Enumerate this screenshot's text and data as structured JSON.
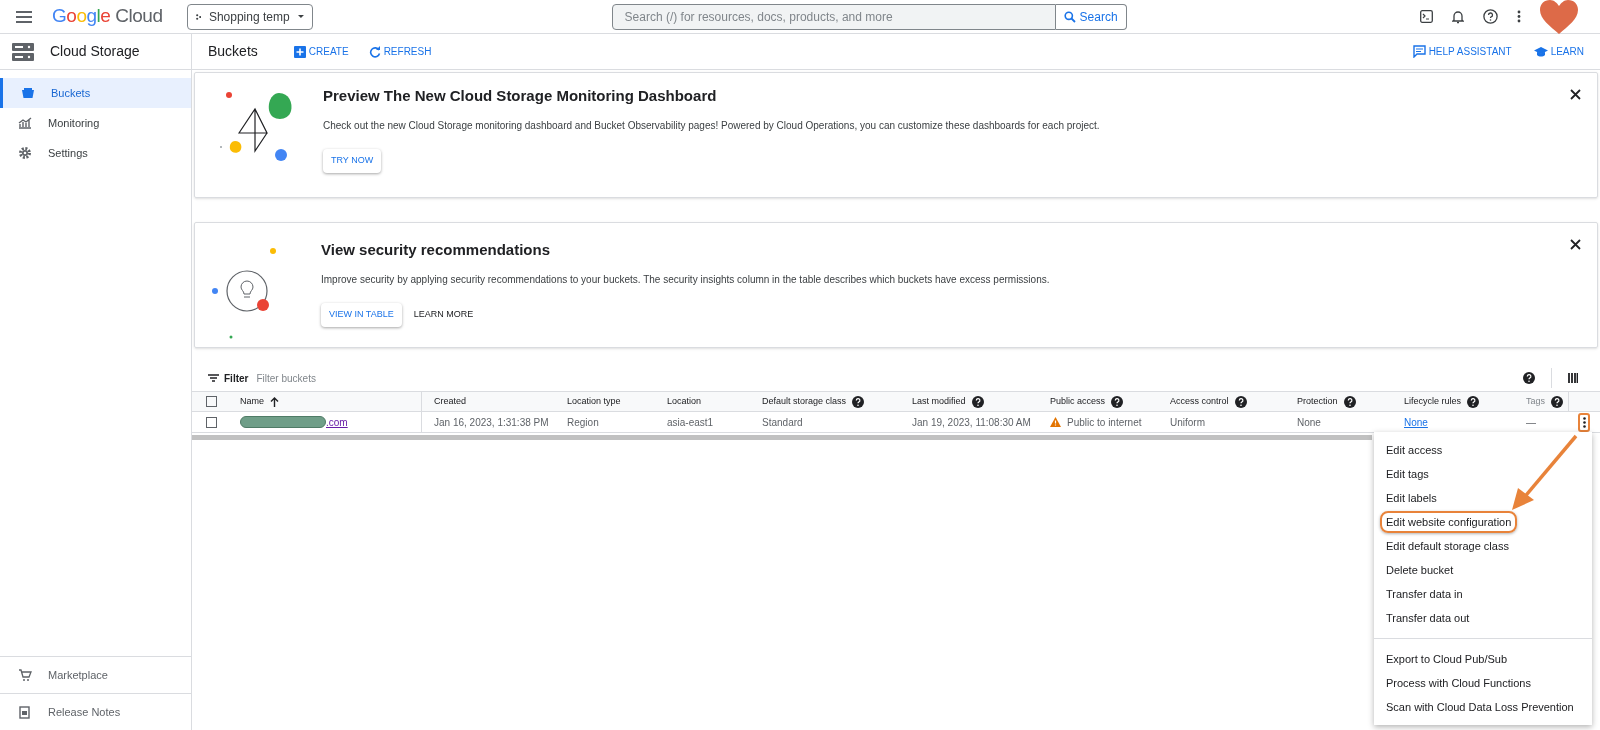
{
  "topbar": {
    "logo_parts": [
      "Google",
      "Cloud"
    ],
    "project": "Shopping temp",
    "search_placeholder": "Search (/) for resources, docs, products, and more",
    "search_button": "Search"
  },
  "sidebar": {
    "title": "Cloud Storage",
    "items": [
      {
        "label": "Buckets",
        "selected": true
      },
      {
        "label": "Monitoring",
        "selected": false
      },
      {
        "label": "Settings",
        "selected": false
      }
    ],
    "footer_items": [
      {
        "label": "Marketplace"
      },
      {
        "label": "Release Notes"
      }
    ]
  },
  "header": {
    "title": "Buckets",
    "actions": [
      {
        "label": "CREATE"
      },
      {
        "label": "REFRESH"
      }
    ],
    "right_actions": [
      {
        "label": "HELP ASSISTANT"
      },
      {
        "label": "LEARN"
      }
    ]
  },
  "cards": [
    {
      "kind": "dashboard",
      "title": "Preview The New Cloud Storage Monitoring Dashboard",
      "text": "Check out the new Cloud Storage monitoring dashboard and Bucket Observability pages! Powered by Cloud Operations, you can customize these dashboards for each project.",
      "buttons": [
        "TRY NOW"
      ]
    },
    {
      "kind": "security",
      "title": "View security recommendations",
      "text": "Improve security by applying security recommendations to your buckets. The security insights column in the table describes which buckets have excess permissions.",
      "buttons": [
        "VIEW IN TABLE",
        "LEARN MORE"
      ]
    }
  ],
  "table": {
    "filter_label": "Filter",
    "filter_placeholder": "Filter buckets",
    "all_checked": false,
    "columns": [
      {
        "label": "Name",
        "help": false,
        "sorted": true
      },
      {
        "label": "Created",
        "help": false
      },
      {
        "label": "Location type",
        "help": false
      },
      {
        "label": "Location",
        "help": false
      },
      {
        "label": "Default storage class",
        "help": true
      },
      {
        "label": "Last modified",
        "help": true
      },
      {
        "label": "Public access",
        "help": true
      },
      {
        "label": "Access control",
        "help": true
      },
      {
        "label": "Protection",
        "help": true
      },
      {
        "label": "Lifecycle rules",
        "help": true
      },
      {
        "label": "Tags",
        "help": true
      }
    ],
    "rows": [
      {
        "checked": false,
        "name_redacted": true,
        "cells": [
          ".com",
          "Jan 16, 2023, 1:31:38 PM",
          "Region",
          "asia-east1",
          "Standard",
          "Jan 19, 2023, 11:08:30 AM",
          "Public to internet",
          "Uniform",
          "None",
          "None",
          "—"
        ]
      }
    ]
  },
  "menu": {
    "groups": [
      [
        {
          "label": "Edit access",
          "highlight": false
        },
        {
          "label": "Edit tags",
          "highlight": false
        },
        {
          "label": "Edit labels",
          "highlight": false
        },
        {
          "label": "Edit website configuration",
          "highlight": true
        },
        {
          "label": "Edit default storage class",
          "highlight": false
        },
        {
          "label": "Delete bucket",
          "highlight": false
        },
        {
          "label": "Transfer data in",
          "highlight": false
        },
        {
          "label": "Transfer data out",
          "highlight": false
        }
      ],
      [
        {
          "label": "Export to Cloud Pub/Sub",
          "highlight": false
        },
        {
          "label": "Process with Cloud Functions",
          "highlight": false
        },
        {
          "label": "Scan with Cloud Data Loss Prevention",
          "highlight": false
        }
      ]
    ]
  }
}
